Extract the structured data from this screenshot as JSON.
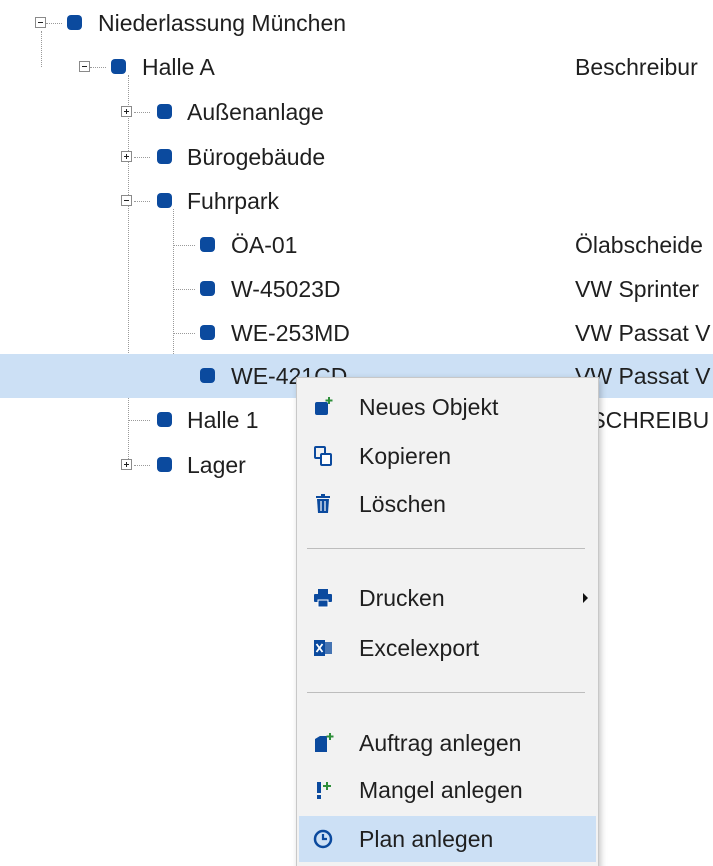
{
  "tree": {
    "root": {
      "label": "Niederlassung München"
    },
    "halle_a": {
      "label": "Halle A",
      "description": "Beschreibur"
    },
    "aussenanlage": {
      "label": "Außenanlage"
    },
    "buerogebaeude": {
      "label": "Bürogebäude"
    },
    "fuhrpark": {
      "label": "Fuhrpark"
    },
    "vehicles": [
      {
        "label": "ÖA-01",
        "description": "Ölabscheide"
      },
      {
        "label": "W-45023D",
        "description": "VW Sprinter"
      },
      {
        "label": "WE-253MD",
        "description": "VW Passat V"
      },
      {
        "label": "WE-421CD",
        "description": "VW Passat V"
      }
    ],
    "halle_1": {
      "label": "Halle 1",
      "description": "ESCHREIBU"
    },
    "lager": {
      "label": "Lager"
    }
  },
  "context_menu": {
    "items": [
      {
        "label": "Neues Objekt",
        "icon": "new-object-icon"
      },
      {
        "label": "Kopieren",
        "icon": "copy-icon"
      },
      {
        "label": "Löschen",
        "icon": "trash-icon"
      },
      {
        "label": "Drucken",
        "icon": "printer-icon",
        "has_submenu": true
      },
      {
        "label": "Excelexport",
        "icon": "excel-icon"
      },
      {
        "label": "Auftrag anlegen",
        "icon": "create-order-icon"
      },
      {
        "label": "Mangel anlegen",
        "icon": "create-defect-icon"
      },
      {
        "label": "Plan anlegen",
        "icon": "clock-icon",
        "highlighted": true
      }
    ]
  },
  "colors": {
    "node_icon": "#0b4a9e",
    "selection": "#cce0f5",
    "menu_background": "#f2f2f2"
  }
}
